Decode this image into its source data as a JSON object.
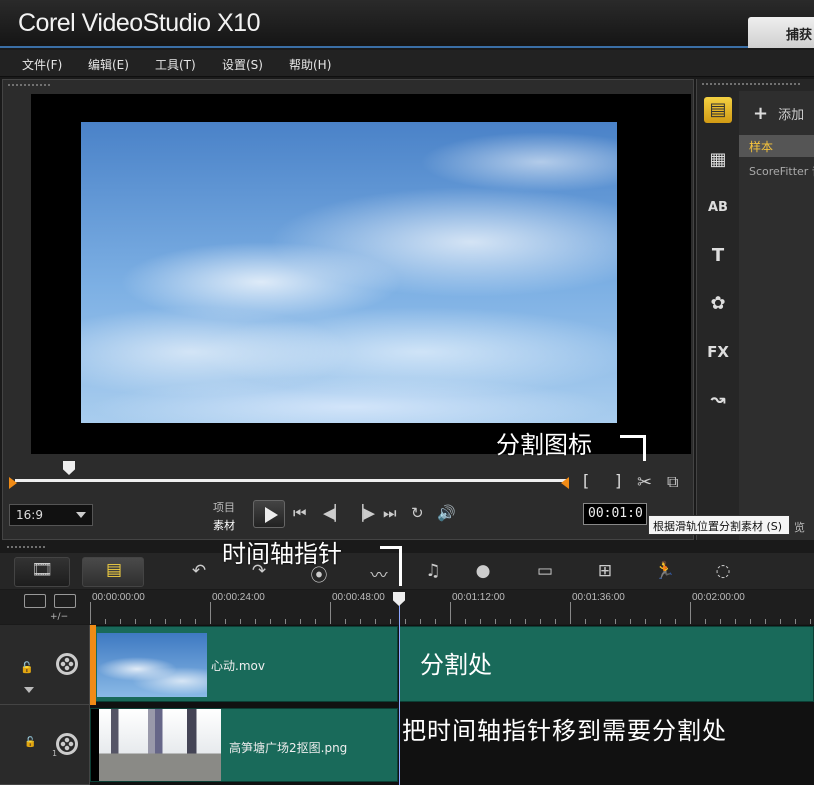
{
  "app": {
    "title": "Corel VideoStudio X10",
    "capture_tab": "捕获"
  },
  "menu": [
    "文件(F)",
    "编辑(E)",
    "工具(T)",
    "设置(S)",
    "帮助(H)"
  ],
  "preview": {
    "aspect_ratio": "16:9",
    "mode_project": "项目",
    "mode_clip": "素材",
    "timecode": "00:01:0",
    "bracket_in": "[",
    "bracket_out": "]",
    "scrub_position": 0.11
  },
  "library": {
    "add_label": "添加",
    "selected_item": "样本",
    "item": "ScoreFitter 音",
    "tail_label": "览",
    "icons": [
      "media-icon",
      "instant-project-icon",
      "transition-icon",
      "title-icon",
      "graphic-icon",
      "filter-icon",
      "path-icon"
    ]
  },
  "tooltip": "根据滑轨位置分割素材 (S)",
  "timeline": {
    "zoom_label": "+/−",
    "ruler_ticks": [
      "00:00:00:00",
      "00:00:24:00",
      "00:00:48:00",
      "00:01:12:00",
      "00:01:36:00",
      "00:02:00:00"
    ],
    "tracks": [
      {
        "clip_name": "心动.mov",
        "overlay_text": "分割处"
      },
      {
        "clip_name": "高笋塘广场2抠图.png",
        "track_number": "1"
      }
    ]
  },
  "annotations": {
    "split_icon": "分割图标",
    "playhead": "时间轴指针",
    "split_point": "分割处",
    "instruction": "把时间轴指针移到需要分割处"
  },
  "colors": {
    "accent": "#3a6ea5",
    "clip_bg": "#196a5a",
    "trim_marker": "#f08b16",
    "library_selected_text": "#f5c33c"
  }
}
